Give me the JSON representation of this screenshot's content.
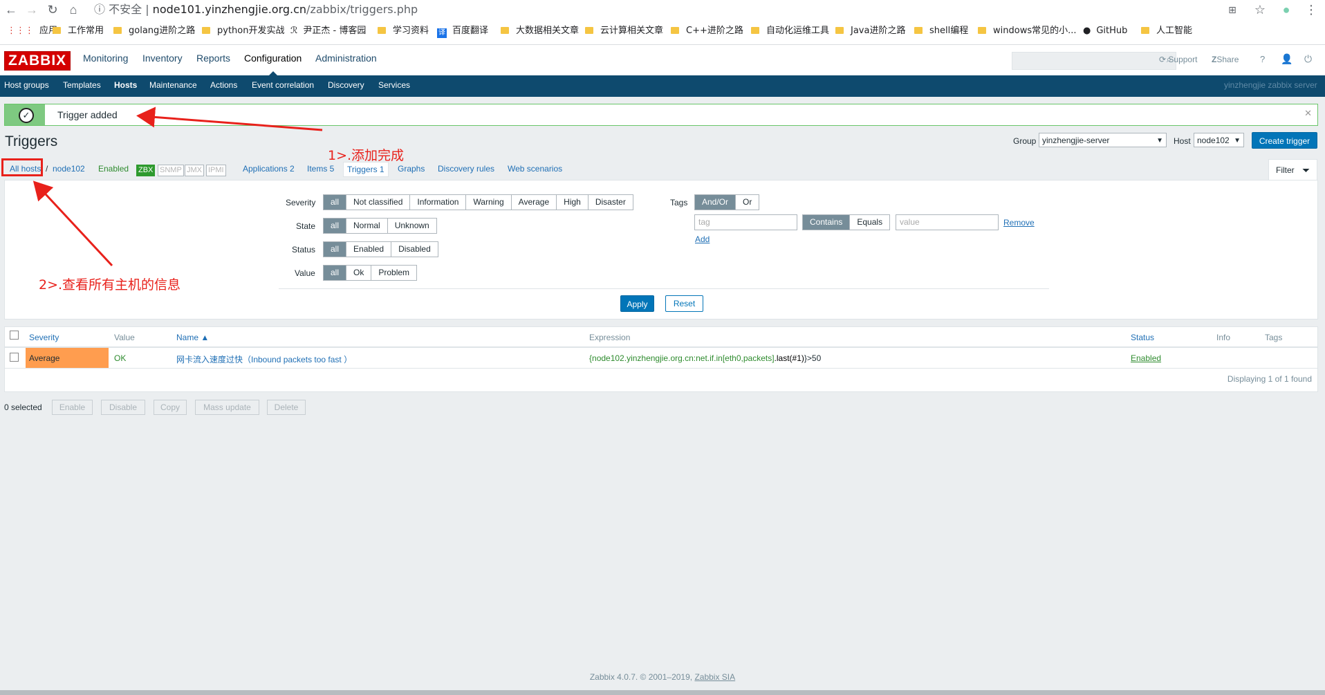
{
  "browser": {
    "security": "不安全",
    "url_host": "node101.yinzhengjie.org.cn",
    "url_path": "/zabbix/triggers.php",
    "bookmarks": [
      "应用",
      "工作常用",
      "golang进阶之路",
      "python开发实战",
      "尹正杰 - 博客园",
      "学习资料",
      "百度翻译",
      "大数据相关文章",
      "云计算相关文章",
      "C++进阶之路",
      "自动化运维工具",
      "Java进阶之路",
      "shell编程",
      "windows常见的小...",
      "GitHub",
      "人工智能"
    ]
  },
  "header": {
    "logo": "ZABBIX",
    "menu": [
      "Monitoring",
      "Inventory",
      "Reports",
      "Configuration",
      "Administration"
    ],
    "support": "Support",
    "share": "Share",
    "help": "?"
  },
  "navbar": {
    "items": [
      "Host groups",
      "Templates",
      "Hosts",
      "Maintenance",
      "Actions",
      "Event correlation",
      "Discovery",
      "Services"
    ],
    "server_name": "yinzhengjie zabbix server"
  },
  "message": {
    "text": "Trigger added"
  },
  "page": {
    "title": "Triggers",
    "group_label": "Group",
    "group_value": "yinzhengjie-server",
    "host_label": "Host",
    "host_value": "node102",
    "create_button": "Create trigger",
    "filter_tab": "Filter"
  },
  "hostnav": {
    "all_hosts": "All hosts",
    "sep": "/",
    "host": "node102",
    "status": "Enabled",
    "zbx": "ZBX",
    "snmp": "SNMP",
    "jmx": "JMX",
    "ipmi": "IPMI",
    "applications": "Applications 2",
    "items": "Items 5",
    "triggers": "Triggers 1",
    "graphs": "Graphs",
    "discovery": "Discovery rules",
    "web": "Web scenarios"
  },
  "filter": {
    "severity_label": "Severity",
    "severity_options": [
      "all",
      "Not classified",
      "Information",
      "Warning",
      "Average",
      "High",
      "Disaster"
    ],
    "state_label": "State",
    "state_options": [
      "all",
      "Normal",
      "Unknown"
    ],
    "status_label": "Status",
    "status_options": [
      "all",
      "Enabled",
      "Disabled"
    ],
    "value_label": "Value",
    "value_options": [
      "all",
      "Ok",
      "Problem"
    ],
    "tags_label": "Tags",
    "tags_options": [
      "And/Or",
      "Or"
    ],
    "tag_placeholder": "tag",
    "match_options": [
      "Contains",
      "Equals"
    ],
    "value_placeholder": "value",
    "remove": "Remove",
    "add": "Add",
    "apply": "Apply",
    "reset": "Reset"
  },
  "table": {
    "headers": [
      "Severity",
      "Value",
      "Name ▲",
      "Expression",
      "Status",
      "Info",
      "Tags"
    ],
    "rows": [
      {
        "severity": "Average",
        "value": "OK",
        "name": "网卡流入速度过快（Inbound packets too fast ）",
        "expr_open": "{",
        "expr_host": "node102.yinzhengjie.org.cn:net.if.in[eth0,packets]",
        "expr_fn": ".last(#1)",
        "expr_close": "}>50",
        "status": "Enabled"
      }
    ],
    "footer": "Displaying 1 of 1 found"
  },
  "bottom": {
    "selected": "0 selected",
    "buttons": [
      "Enable",
      "Disable",
      "Copy",
      "Mass update",
      "Delete"
    ]
  },
  "footer": {
    "text": "Zabbix 4.0.7. © 2001–2019, ",
    "link": "Zabbix SIA"
  },
  "annotations": {
    "a1": "1>.添加完成",
    "a2": "2>.查看所有主机的信息"
  },
  "colors": {
    "brand_red": "#d40000",
    "nav_blue": "#0e4a6e",
    "button_blue": "#0275b8",
    "average_orange": "#ff9d4f",
    "ok_green": "#2e8b2e",
    "annotation_red": "#e8211b"
  }
}
